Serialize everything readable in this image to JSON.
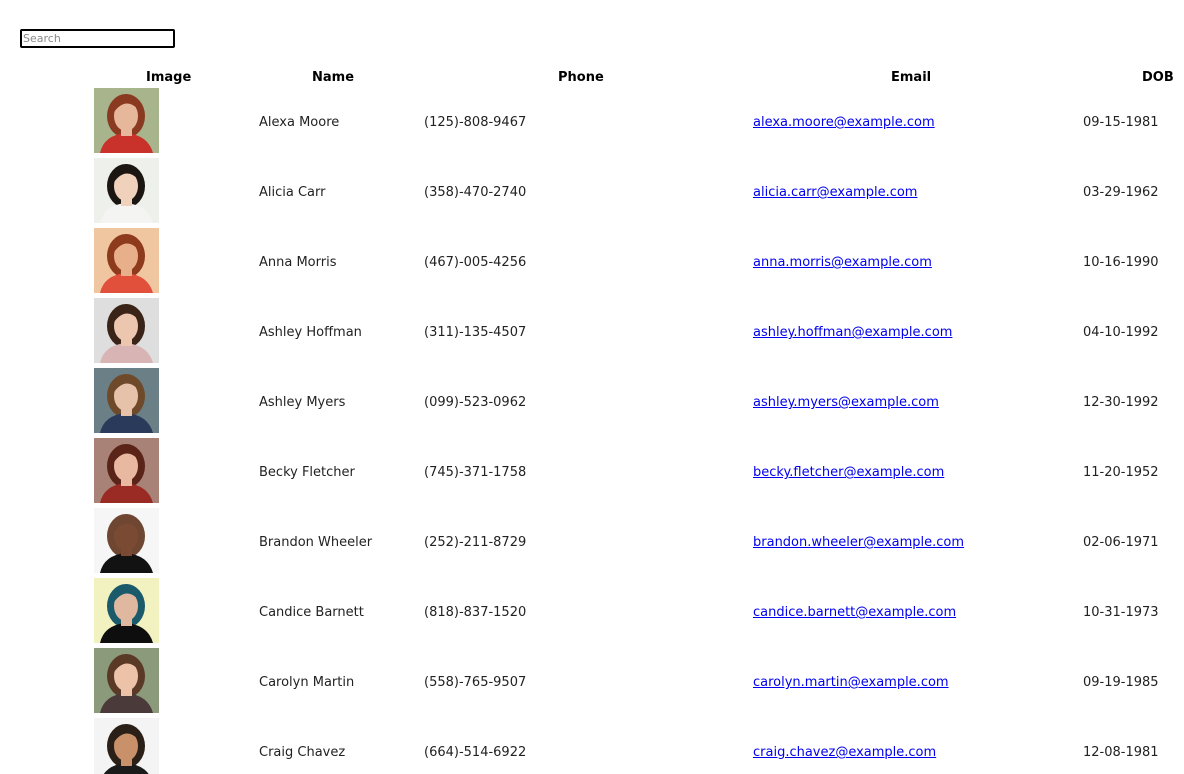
{
  "search": {
    "placeholder": "Search",
    "value": ""
  },
  "table": {
    "headers": {
      "image": "Image",
      "name": "Name",
      "phone": "Phone",
      "email": "Email",
      "dob": "DOB"
    },
    "rows": [
      {
        "name": "Alexa Moore",
        "phone": "(125)-808-9467",
        "email": "alexa.moore@example.com",
        "dob": "09-15-1981",
        "photo": {
          "bg": "#a8b48c",
          "hair": "#8a3a20",
          "skin": "#e6b79a",
          "shirt": "#c8322a"
        }
      },
      {
        "name": "Alicia Carr",
        "phone": "(358)-470-2740",
        "email": "alicia.carr@example.com",
        "dob": "03-29-1962",
        "photo": {
          "bg": "#eef0ec",
          "hair": "#1c1612",
          "skin": "#f0d2bc",
          "shirt": "#f4f4f2"
        }
      },
      {
        "name": "Anna Morris",
        "phone": "(467)-005-4256",
        "email": "anna.morris@example.com",
        "dob": "10-16-1990",
        "photo": {
          "bg": "#f0c6a0",
          "hair": "#8e3a1c",
          "skin": "#e8b08a",
          "shirt": "#e0503a"
        }
      },
      {
        "name": "Ashley Hoffman",
        "phone": "(311)-135-4507",
        "email": "ashley.hoffman@example.com",
        "dob": "04-10-1992",
        "photo": {
          "bg": "#dedede",
          "hair": "#3a2418",
          "skin": "#ecc6ae",
          "shirt": "#d8b4b4"
        }
      },
      {
        "name": "Ashley Myers",
        "phone": "(099)-523-0962",
        "email": "ashley.myers@example.com",
        "dob": "12-30-1992",
        "photo": {
          "bg": "#6a7f86",
          "hair": "#6e4a2a",
          "skin": "#e6c2aa",
          "shirt": "#2a3a5a"
        }
      },
      {
        "name": "Becky Fletcher",
        "phone": "(745)-371-1758",
        "email": "becky.fletcher@example.com",
        "dob": "11-20-1952",
        "photo": {
          "bg": "#a88276",
          "hair": "#5a2418",
          "skin": "#e8b8a0",
          "shirt": "#9a2a24"
        }
      },
      {
        "name": "Brandon Wheeler",
        "phone": "(252)-211-8729",
        "email": "brandon.wheeler@example.com",
        "dob": "02-06-1971",
        "photo": {
          "bg": "#f6f6f6",
          "hair": "#6e4632",
          "skin": "#7a4a32",
          "shirt": "#121212"
        }
      },
      {
        "name": "Candice Barnett",
        "phone": "(818)-837-1520",
        "email": "candice.barnett@example.com",
        "dob": "10-31-1973",
        "photo": {
          "bg": "#f2f2c0",
          "hair": "#1a5a6a",
          "skin": "#e0b8a0",
          "shirt": "#0e0e0e"
        }
      },
      {
        "name": "Carolyn Martin",
        "phone": "(558)-765-9507",
        "email": "carolyn.martin@example.com",
        "dob": "09-19-1985",
        "photo": {
          "bg": "#8a9a7a",
          "hair": "#5a3a26",
          "skin": "#ecc2a8",
          "shirt": "#4a3a3a"
        }
      },
      {
        "name": "Craig Chavez",
        "phone": "(664)-514-6922",
        "email": "craig.chavez@example.com",
        "dob": "12-08-1981",
        "photo": {
          "bg": "#f4f4f4",
          "hair": "#2a2018",
          "skin": "#c8916a",
          "shirt": "#1a1a1a"
        }
      }
    ]
  }
}
